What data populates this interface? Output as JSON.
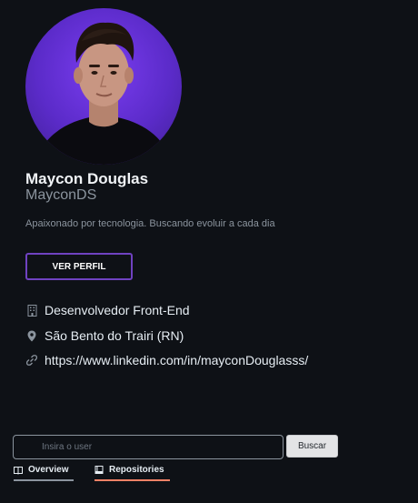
{
  "profile": {
    "name": "Maycon Douglas",
    "username": "MayconDS",
    "bio": "Apaixonado por tecnologia. Buscando evoluir a cada dia",
    "view_profile_label": "VER PERFIL",
    "avatar_alt": "avatar"
  },
  "info": {
    "company": "Desenvolvedor Front-End",
    "location": "São Bento do Trairi (RN)",
    "link": "https://www.linkedin.com/in/mayconDouglasss/"
  },
  "search": {
    "placeholder": "Insira o user",
    "value": "",
    "button_label": "Buscar"
  },
  "tabs": [
    {
      "label": "Overview",
      "icon": "book-icon"
    },
    {
      "label": "Repositories",
      "icon": "repo-icon"
    }
  ],
  "colors": {
    "background": "#0e1116",
    "accent": "#6f42c1",
    "active_tab": "#f78166",
    "avatar_bg": "#5b2bc9"
  }
}
